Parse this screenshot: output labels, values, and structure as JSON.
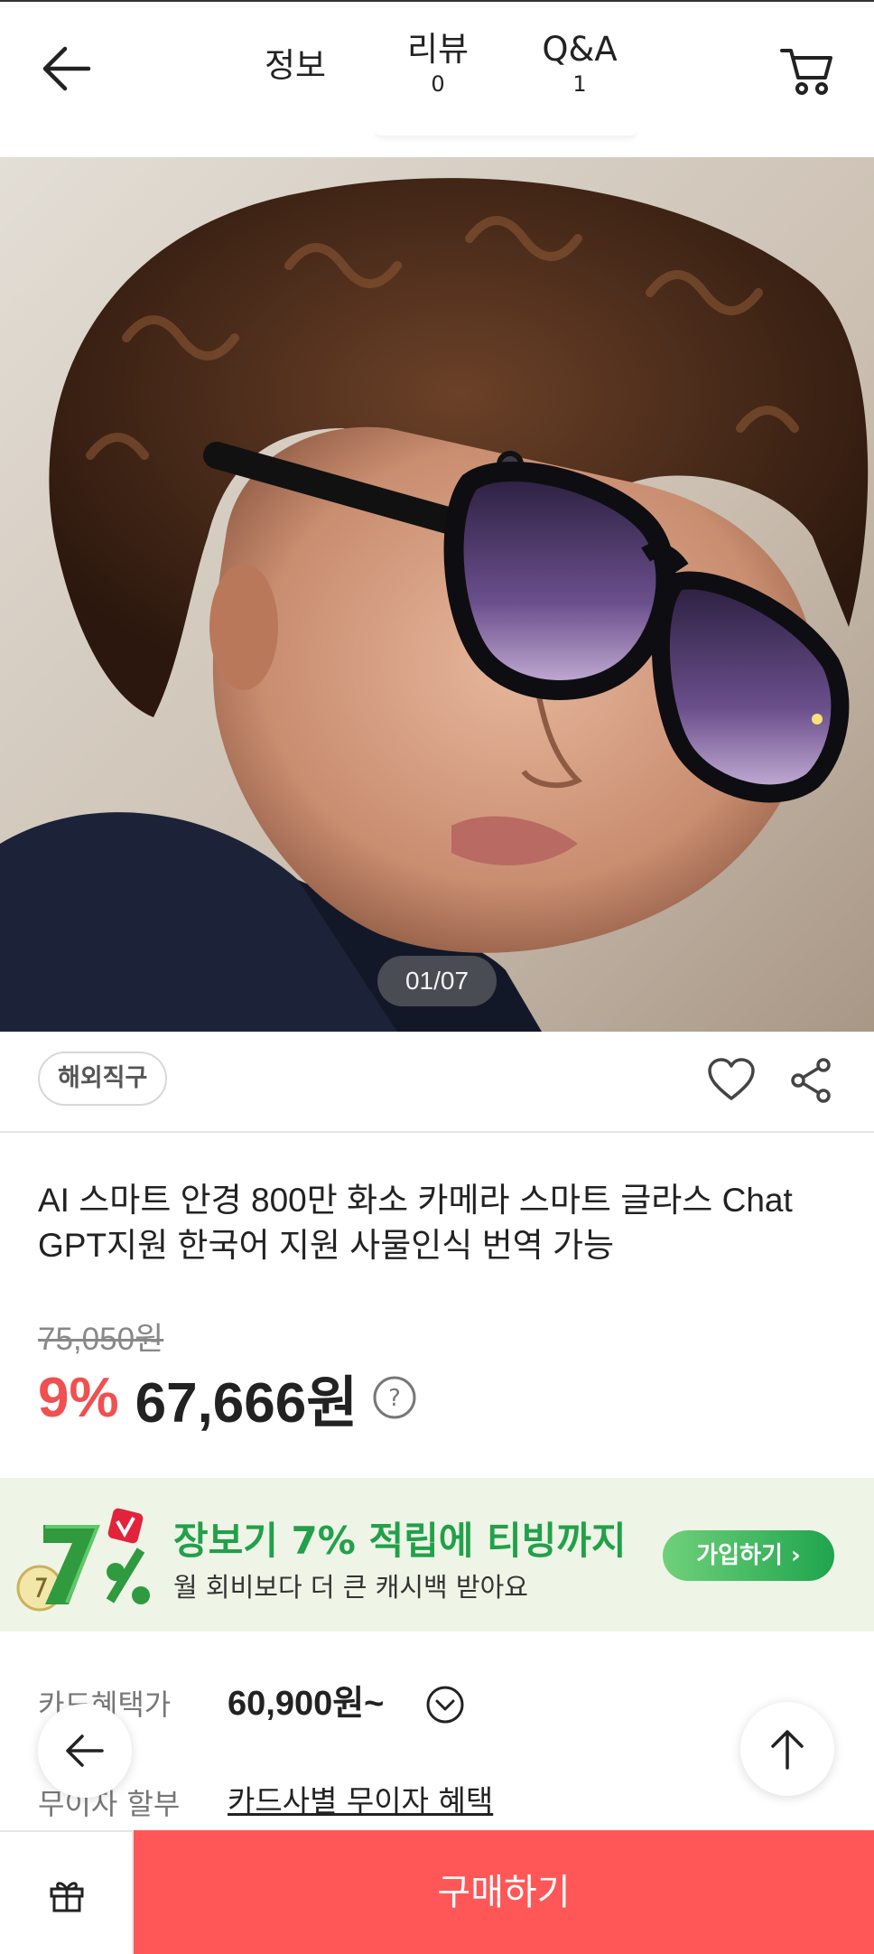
{
  "header": {
    "tabs": [
      {
        "label": "정보",
        "count": ""
      },
      {
        "label": "리뷰",
        "count": "0"
      },
      {
        "label": "Q&A",
        "count": "1"
      }
    ],
    "back_icon": "arrow-left-icon",
    "cart_icon": "cart-icon"
  },
  "gallery": {
    "counter": "01/07"
  },
  "product": {
    "badge": "해외직구",
    "title": "AI 스마트 안경 800만 화소 카메라 스마트 글라스 Chat GPT지원 한국어 지원 사물인식 번역 가능",
    "original_price": "75,050원",
    "discount": "9%",
    "sale_price": "67,666원"
  },
  "promo": {
    "title": "장보기 7% 적립에 티빙까지",
    "subtitle": "월 회비보다 더 큰 캐시백 받아요",
    "button": "가입하기 ›",
    "accent": "#22a04a"
  },
  "benefits": {
    "card_label": "카드혜택가",
    "card_value": "60,900원~",
    "installment_label": "무이자 할부",
    "installment_link": "카드사별 무이자 혜택"
  },
  "bottom": {
    "buy_label": "구매하기",
    "buy_color": "#ff5757"
  }
}
